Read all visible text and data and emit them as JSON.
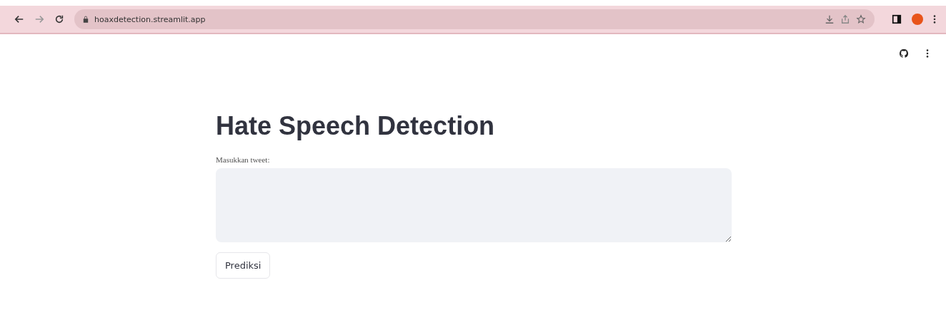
{
  "browser": {
    "url": "hoaxdetection.streamlit.app"
  },
  "page": {
    "title": "Hate Speech Detection",
    "input_label": "Masukkan tweet:",
    "button": "Prediksi"
  }
}
